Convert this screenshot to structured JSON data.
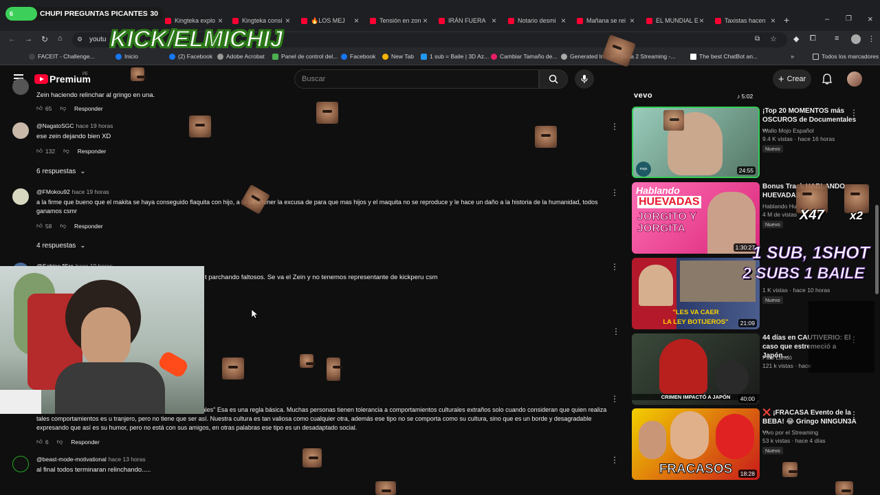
{
  "browser": {
    "tabs": [
      {
        "title": "Kingteka explo"
      },
      {
        "title": "Kingteka consi"
      },
      {
        "title": "🔥LOS MEJ"
      },
      {
        "title": "Tensión en zon"
      },
      {
        "title": "IRÁN FUERA"
      },
      {
        "title": "Notario desmi"
      },
      {
        "title": "Mañana se rei"
      },
      {
        "title": "EL MUNDIAL E"
      },
      {
        "title": "Taxistas hacen"
      }
    ],
    "address": "youtu",
    "bookmarks": [
      {
        "label": "FACEIT - Challenge..."
      },
      {
        "label": "Inicio"
      },
      {
        "label": "(2) Facebook"
      },
      {
        "label": "Adobe Acrobat"
      },
      {
        "label": "Panel de control del..."
      },
      {
        "label": "Facebook"
      },
      {
        "label": "New Tab"
      },
      {
        "label": "1 sub = Baile | 3D Az..."
      },
      {
        "label": "Cambiar Tamaño de..."
      },
      {
        "label": "Generated Image"
      },
      {
        "label": "Dota 2 Streaming -..."
      },
      {
        "label": "The best ChatBot an..."
      },
      {
        "label": "Todos los marcadores"
      }
    ]
  },
  "stream_overlay": {
    "goal_label": "CHUPI PREGUNTAS PICANTES",
    "goal_count": "30",
    "goal_pill": "6",
    "channel": "KICK/ELMICHIJ",
    "promo_line1": "1 SUB, 1SHOT",
    "promo_line2": "2 SUBS 1 BAILE",
    "multiplier_1": "X47",
    "multiplier_2": "x2"
  },
  "youtube_header": {
    "logo": "Premium",
    "region": "PE",
    "search_placeholder": "Buscar",
    "create_label": "Crear"
  },
  "comments": [
    {
      "handle": "",
      "time": "",
      "text": "Zein haciendo relinchar al gringo en una.",
      "likes": "65",
      "reply": "Responder"
    },
    {
      "handle": "@NagatoSGC",
      "time": "hace 19 horas",
      "text": "ese zein dejando bien XD",
      "likes": "132",
      "reply": "Responder",
      "replies": "6 respuestas"
    },
    {
      "handle": "@FMokou92",
      "time": "hace 19 horas",
      "text": "a la firme que bueno que el makita se haya conseguido flaquita con hijo, a            ta va a tener la excusa de para que mas hijos y el maquita no se reproduce y le hace un daño a la historia de la humanidad, todos ganamos csmr",
      "likes": "58",
      "reply": "Responder",
      "replies": "4 respuestas"
    },
    {
      "handle": "@Sabino.fi5ro",
      "time": "hace 19 horas",
      "text": "t parchando faltosos. Se va el Zein y no tenemos representante de kickperu csm"
    },
    {
      "handle": "",
      "time": "",
      "text": "en que venir de quien se inserta en una cultura no de los locales\" Esa es una regla básica. Muchas personas tienen tolerancia a comportamientos culturales extraños solo cuando consideran que quien realiza tales comportamientos es u    tranjero, pero no tiene que ser así. Nuestra cultura es tan valiosa como cualquier otra, además ese tipo no se comporta como su cultura, sino que es un borde y desagradable expresando que así es su humor, pero no está con sus amigos, en otras palabras ese tipo es un desadaptado social.",
      "likes": "6",
      "reply": "Responder"
    },
    {
      "handle": "@beast-mode-motivational",
      "time": "hace 13 horas",
      "text": "al final todos terminaran relinchando.....",
      "reply": "Responder"
    }
  ],
  "sidebar": {
    "top_label": "vevo",
    "top_duration": "5:02",
    "videos": [
      {
        "title": "¡Top 20 MOMENTOS más OSCUROS de Documentales ...",
        "channel": "Wallo Mojo Español",
        "meta": "9.4 K vistas · hace 16 horas",
        "badge": "Nuevo",
        "duration": "24:55",
        "thumb_brand": "mojo"
      },
      {
        "title": "Bonus Track HABLANDO HUEVADAS ...",
        "channel": "Hablando Hu",
        "meta": "4 M de vistas",
        "badge": "Nuevo",
        "duration": "1:30:27",
        "thumb_text1": "Hablando",
        "thumb_text2": "HUEVADAS",
        "thumb_text3": "JORGITO Y JORGITA"
      },
      {
        "title": "...",
        "channel": "",
        "meta": "1 K vistas · hace 10 horas",
        "badge": "Nuevo",
        "duration": "21:09",
        "thumb_text1": "\"LES VA CAER",
        "thumb_text2": "LA LEY BOTIJEROS\""
      },
      {
        "title": "44 días en CAUTIVERIO: El caso que estremeció a Japón...",
        "channel": "Paul Landó",
        "meta": "121 k vistas · hace",
        "badge": "Nuevo",
        "duration": "40:00",
        "thumb_text1": "CRIMEN IMPACTÓ A JAPÓN"
      },
      {
        "title": "❌ ¡FRACASA Evento de la BEBA! 😂 Gringo NINGUN3A ...",
        "channel": "Vivo por el Streaming",
        "meta": "53 k vistas · hace 4 días",
        "badge": "Nuevo",
        "duration": "18:28",
        "thumb_text1": "FRACASOS"
      }
    ]
  },
  "colors": {
    "bg": "#0f0f0f",
    "yt_red": "#ff0033",
    "kick_green": "#53fc18"
  }
}
